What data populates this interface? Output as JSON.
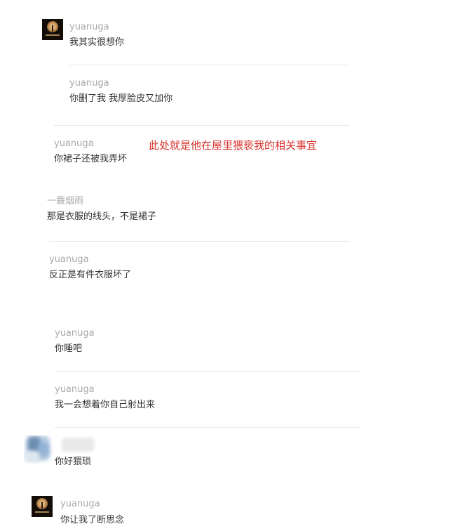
{
  "comments": [
    {
      "user": "yuanuga",
      "text": "我其实很想你"
    },
    {
      "user": "yuanuga",
      "text": "你删了我 我厚脸皮又加你"
    },
    {
      "user": "yuanuga",
      "text": "你裙子还被我弄坏"
    },
    {
      "user": "一蓑烟雨",
      "text": "那是衣服的线头，不是裙子"
    },
    {
      "user": "yuanuga",
      "text": "反正是有件衣服坏了"
    },
    {
      "user": "yuanuga",
      "text": "你睡吧"
    },
    {
      "user": "yuanuga",
      "text": "我一会想着你自己射出来"
    },
    {
      "user": "",
      "text": "你好猥琐"
    },
    {
      "user": "yuanuga",
      "text": "你让我了断思念"
    }
  ],
  "annotation": "此处就是他在屋里猥亵我的相关事宜",
  "colors": {
    "username": "#a8a8a8",
    "message": "#333333",
    "annotation": "#d9302c",
    "divider": "#e6e6e6"
  },
  "icons": {
    "user_avatar": "candle-photo-avatar",
    "other_avatar": "blurred-avatar"
  }
}
